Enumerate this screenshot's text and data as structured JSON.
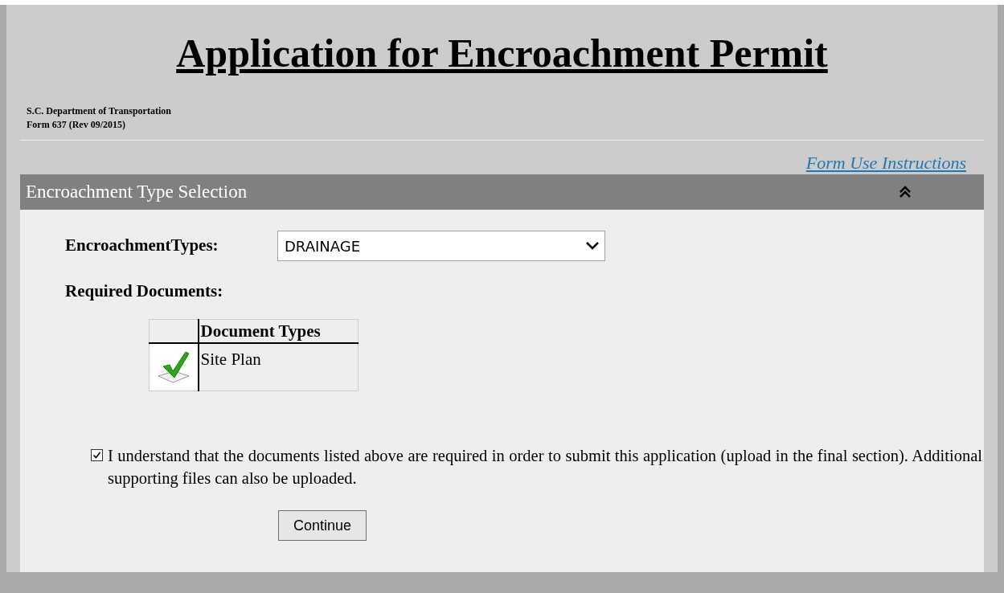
{
  "header": {
    "title": "Application for Encroachment Permit",
    "agency": "S.C. Department of Transportation",
    "form": "Form 637 (Rev 09/2015)"
  },
  "instructions_link": "Form Use Instructions",
  "section": {
    "title": "Encroachment Type Selection",
    "expanded": true
  },
  "encroachment_types": {
    "label": "EncroachmentTypes:",
    "value": "DRAINAGE"
  },
  "required_documents": {
    "label": "Required Documents:",
    "columns": [
      "Document Types"
    ],
    "rows": [
      {
        "provided": true,
        "name": "Site Plan"
      }
    ]
  },
  "acknowledgement": {
    "checked": true,
    "text": "I understand that the documents listed above are required in order to submit this application (upload in the final section). Additional supporting files can also be uploaded."
  },
  "buttons": [
    "Continue"
  ]
}
